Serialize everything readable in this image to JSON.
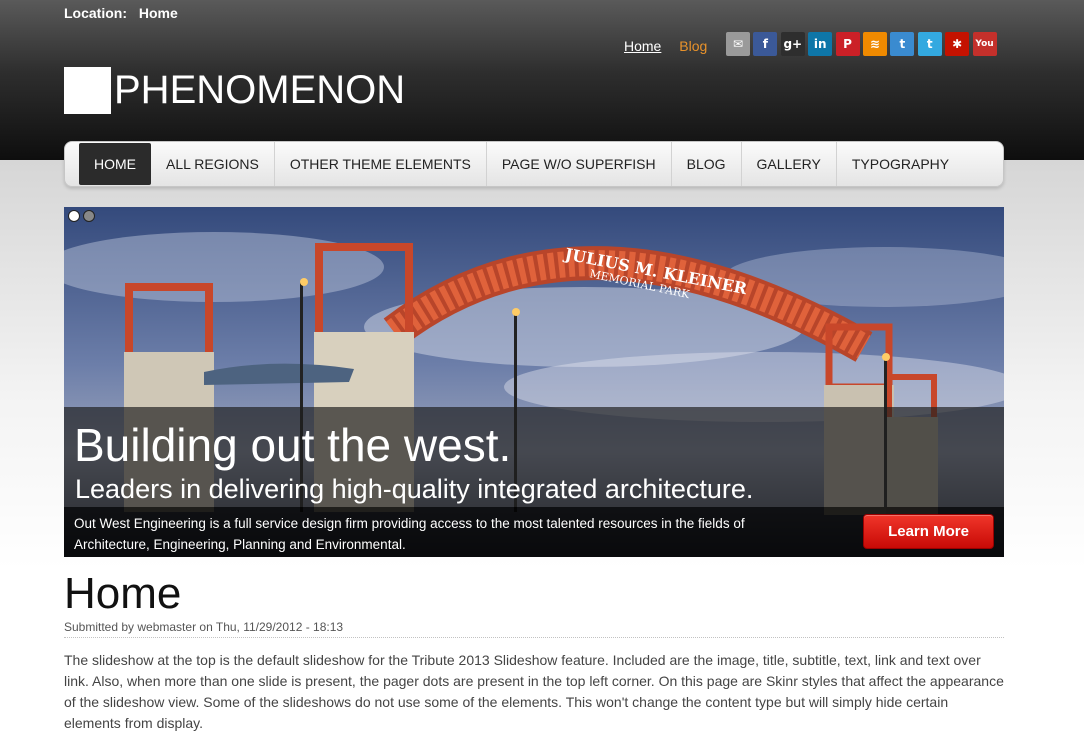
{
  "location": {
    "label": "Location:",
    "value": "Home"
  },
  "toplinks": {
    "home": "Home",
    "blog": "Blog"
  },
  "social": [
    {
      "name": "email",
      "glyph": "✉",
      "color": "#9a9a9a"
    },
    {
      "name": "facebook",
      "glyph": "f",
      "color": "#3b5998"
    },
    {
      "name": "google-plus",
      "glyph": "g+",
      "color": "#2e2e2e"
    },
    {
      "name": "linkedin",
      "glyph": "in",
      "color": "#0e76a8"
    },
    {
      "name": "pinterest",
      "glyph": "P",
      "color": "#cb2027"
    },
    {
      "name": "rss",
      "glyph": "≋",
      "color": "#f08a00"
    },
    {
      "name": "tumblr",
      "glyph": "t",
      "color": "#3a8bd0"
    },
    {
      "name": "twitter",
      "glyph": "t",
      "color": "#33a9e0"
    },
    {
      "name": "yelp",
      "glyph": "✱",
      "color": "#c41200"
    },
    {
      "name": "youtube",
      "glyph": "You",
      "color": "#c4302b"
    }
  ],
  "logo": {
    "text": "PHENOMENON"
  },
  "menu": [
    {
      "label": "HOME",
      "active": true
    },
    {
      "label": "ALL REGIONS",
      "active": false
    },
    {
      "label": "OTHER THEME ELEMENTS",
      "active": false
    },
    {
      "label": "PAGE W/O SUPERFISH",
      "active": false
    },
    {
      "label": "BLOG",
      "active": false
    },
    {
      "label": "GALLERY",
      "active": false
    },
    {
      "label": "TYPOGRAPHY",
      "active": false
    }
  ],
  "slide": {
    "title": "Building out the west.",
    "subtitle": "Leaders in delivering high-quality integrated architecture.",
    "text": "Out West Engineering is a full service design firm providing access to the most talented resources in the fields of Architecture, Engineering, Planning and Environmental.",
    "button": "Learn More",
    "arch_line1": "JULIUS M. KLEINER",
    "arch_line2": "MEMORIAL PARK",
    "pager_count": 2,
    "pager_active": 0
  },
  "content": {
    "title": "Home",
    "submitted": "Submitted by webmaster on Thu, 11/29/2012 - 18:13",
    "body": "The slideshow at the top is the default slideshow for the Tribute 2013 Slideshow feature. Included are the image, title, subtitle, text, link and text over link. Also, when more than one slide is present, the pager dots are present in the top left corner. On this page are Skinr styles that affect the appearance of the slideshow view. Some of the slideshows do not use some of the elements. This won't change the content type but will simply hide certain elements from display."
  }
}
